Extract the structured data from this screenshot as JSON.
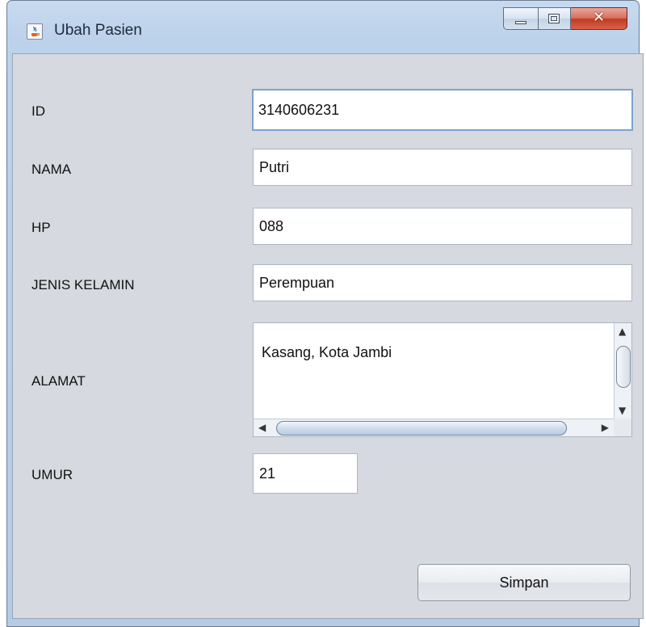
{
  "window": {
    "title": "Ubah Pasien",
    "icon": "java-cup-icon",
    "controls": {
      "minimize": "minimize-icon",
      "maximize": "maximize-icon",
      "close": "✕"
    }
  },
  "form": {
    "id": {
      "label": "ID",
      "value": "3140606231"
    },
    "nama": {
      "label": "NAMA",
      "value": "Putri"
    },
    "hp": {
      "label": "HP",
      "value": "088"
    },
    "jenis_kelamin": {
      "label": "JENIS KELAMIN",
      "value": "Perempuan"
    },
    "alamat": {
      "label": "ALAMAT",
      "value": "Kasang, Kota Jambi"
    },
    "umur": {
      "label": "UMUR",
      "value": "21"
    }
  },
  "actions": {
    "save_label": "Simpan"
  },
  "colors": {
    "window_frame": "#bcd1ea",
    "panel": "#d6d9df",
    "focus_border": "#7da2ce",
    "close_button": "#c23a22"
  }
}
